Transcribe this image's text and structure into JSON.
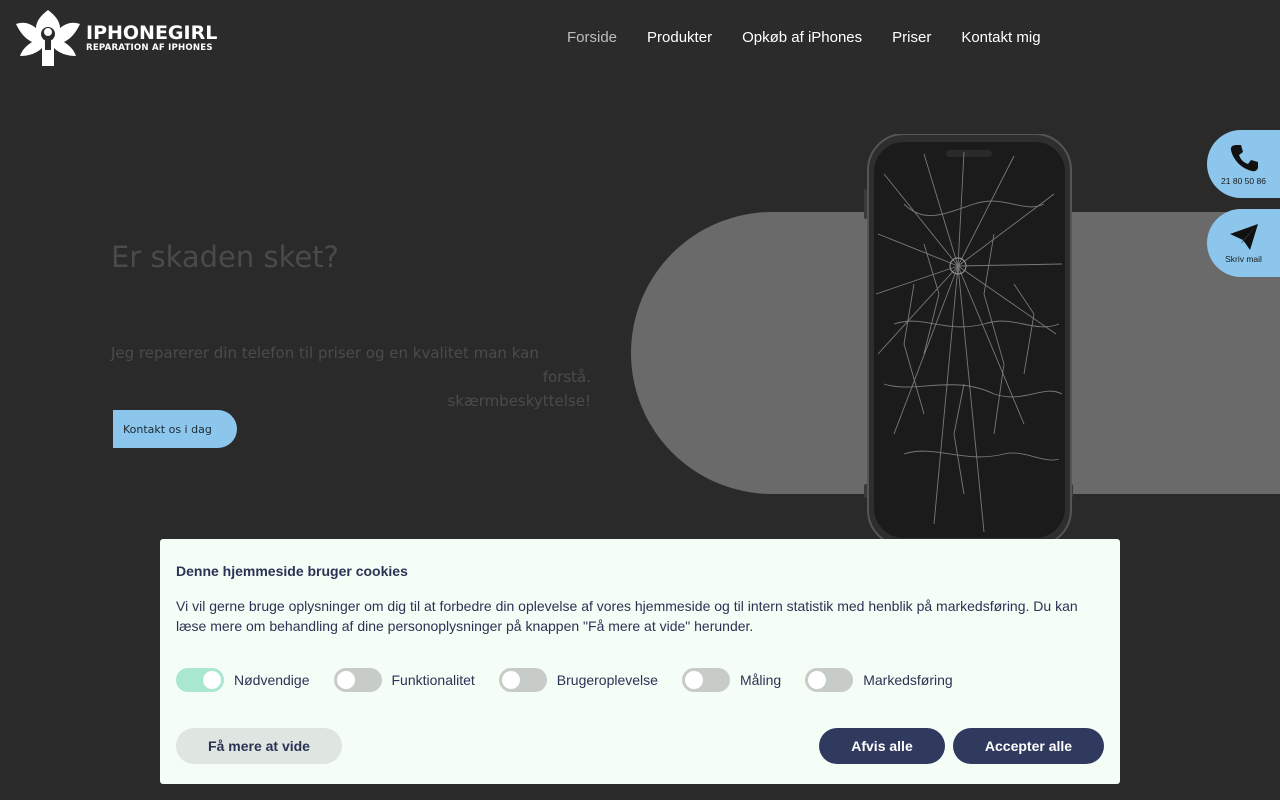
{
  "header": {
    "logo_title": "IPHONEGIRL",
    "logo_subtitle": "REPARATION AF IPHONES",
    "nav": [
      {
        "label": "Forside"
      },
      {
        "label": "Produkter"
      },
      {
        "label": "Opkøb af iPhones"
      },
      {
        "label": "Priser"
      },
      {
        "label": "Kontakt mig"
      }
    ]
  },
  "hero": {
    "title": "Er skaden sket?",
    "text_line1": "Jeg reparerer din telefon til priser og en kvalitet man kan forstå.",
    "text_line2": "skærmbeskyttelse!",
    "cta_label": "Kontakt os i dag"
  },
  "side": {
    "phone_label": "21 80 50 86",
    "mail_label": "Skriv mail"
  },
  "cookie": {
    "title": "Denne hjemmeside bruger cookies",
    "body": "Vi vil gerne bruge oplysninger om dig til at forbedre din oplevelse af vores hjemmeside og til intern statistik med henblik på markedsføring. Du kan læse mere om behandling af dine personoplysninger på knappen \"Få mere at vide\" herunder.",
    "toggles": [
      {
        "label": "Nødvendige",
        "on": true
      },
      {
        "label": "Funktionalitet",
        "on": false
      },
      {
        "label": "Brugeroplevelse",
        "on": false
      },
      {
        "label": "Måling",
        "on": false
      },
      {
        "label": "Markedsføring",
        "on": false
      }
    ],
    "more_label": "Få mere at vide",
    "decline_label": "Afvis alle",
    "accept_label": "Accepter alle"
  },
  "colors": {
    "accent": "#8dc6ec",
    "cookie_button": "#2f3a5e",
    "toggle_on": "#a9e8cf"
  }
}
